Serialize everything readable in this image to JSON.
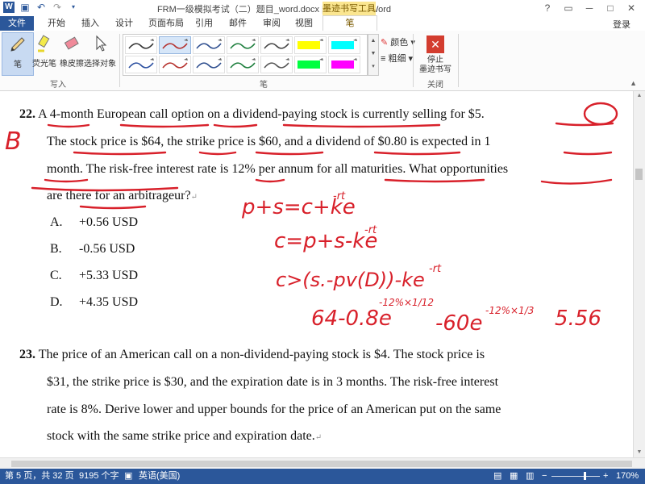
{
  "window": {
    "title": "FRM一级模拟考试（二）题目_word.docx [兼容模式] - Word",
    "controls": [
      "?",
      "▭",
      "─",
      "□",
      "✕"
    ]
  },
  "tabs": {
    "file": "文件",
    "items": [
      "开始",
      "插入",
      "设计",
      "页面布局",
      "引用",
      "邮件",
      "审阅",
      "视图"
    ],
    "context_group": "墨迹书写工具",
    "active": "笔"
  },
  "login": "登录",
  "ribbon": {
    "tools": [
      "笔",
      "荧光笔",
      "橡皮擦",
      "选择对象"
    ],
    "write_group": "写入",
    "pen_group": "笔",
    "color_label": "颜色",
    "weight_label": "粗细",
    "stop_label_1": "停止",
    "stop_label_2": "墨迹书写",
    "close_group": "关闭",
    "pen_colors": [
      "#333333",
      "#b5302c",
      "#2f4f8f",
      "#1c7e3c",
      "#444444",
      "#2b4fa0",
      "#b5302c",
      "#2f4f8f",
      "#1c7e3c",
      "#555555"
    ],
    "highlighter_colors": [
      "#ffff00",
      "#00ffff",
      "#00ff40",
      "#ff00ff"
    ]
  },
  "document": {
    "q22": {
      "number": "22.",
      "lines": [
        "A 4-month European call option on a dividend-paying stock is currently selling for $5.",
        "The stock price is $64, the strike price is $60, and a dividend of $0.80 is expected in 1",
        "month. The risk-free interest rate is 12% per annum for all maturities. What opportunities",
        "are there for an arbitrageur?"
      ],
      "options": [
        {
          "letter": "A.",
          "text": "+0.56 USD"
        },
        {
          "letter": "B.",
          "text": "-0.56 USD"
        },
        {
          "letter": "C.",
          "text": "+5.33 USD"
        },
        {
          "letter": "D.",
          "text": "+4.35 USD"
        }
      ]
    },
    "q23": {
      "number": "23.",
      "lines": [
        "The price of an American call on a non-dividend-paying stock is $4. The stock price is",
        "$31, the strike price is $30, and the expiration date is in 3 months. The risk-free interest",
        "rate is 8%. Derive lower and upper bounds for the price of an American put on the same",
        "stock with the same strike price and expiration date."
      ]
    },
    "ink": {
      "answer_mark": "B",
      "formula1": "p+s=c+ke",
      "formula1_exp": "-rt",
      "formula2": "c=p+s-ke",
      "formula2_exp": "-rt",
      "formula3": "c>(s.-pv(D))-ke",
      "formula3_exp": "-rt",
      "formula4_a": "64-0.8e",
      "formula4_a_exp": "-12%×1/12",
      "formula4_b": "-60e",
      "formula4_b_exp": "-12%×1/3",
      "result": "5.56",
      "ink_color": "#d8202a"
    }
  },
  "status": {
    "page": "第 5 页，共 32 页",
    "words": "9195 个字",
    "language": "英语(美国)",
    "zoom": "170%"
  }
}
